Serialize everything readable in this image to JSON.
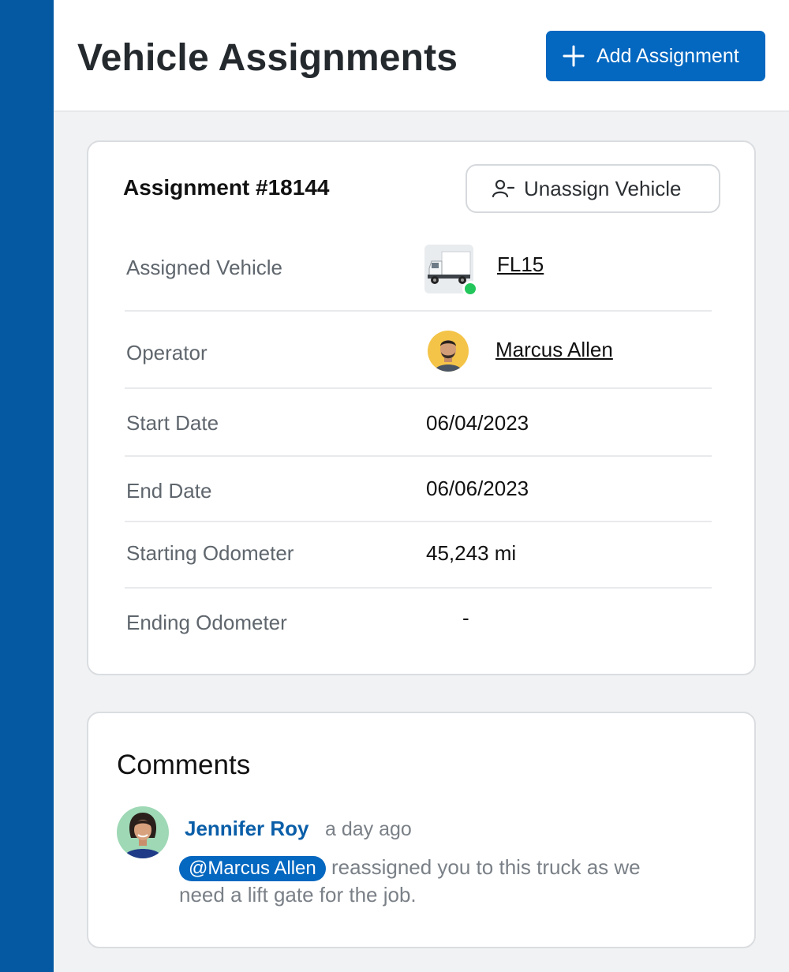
{
  "header": {
    "title": "Vehicle Assignments",
    "add_button_label": "Add Assignment"
  },
  "assignment": {
    "title": "Assignment #18144",
    "unassign_label": "Unassign Vehicle",
    "rows": [
      {
        "label": "Assigned Vehicle",
        "value": "FL15",
        "status": "online",
        "status_color": "#23c65b"
      },
      {
        "label": "Operator",
        "value": "Marcus Allen"
      },
      {
        "label": "Start Date",
        "value": "06/04/2023"
      },
      {
        "label": "End Date",
        "value": "06/06/2023"
      },
      {
        "label": "Starting Odometer",
        "value": "45,243 mi"
      },
      {
        "label": "Ending Odometer",
        "value": "-"
      }
    ]
  },
  "comments": {
    "title": "Comments",
    "items": [
      {
        "author": "Jennifer Roy",
        "time": "a day ago",
        "mention": "@Marcus Allen",
        "text": "reassigned you to this truck as we need a lift gate for the job."
      }
    ]
  },
  "colors": {
    "sidebar": "#0559a3",
    "primary": "#0467c0",
    "link": "#0a5ea8"
  }
}
